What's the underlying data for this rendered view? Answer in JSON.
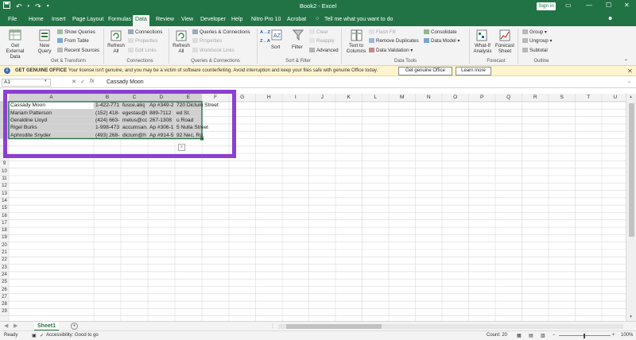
{
  "window": {
    "title": "Book2 - Excel",
    "sign_in": "Sign in",
    "qat_icons": [
      "save-icon",
      "undo-icon",
      "redo-icon",
      "customize-qat-icon"
    ],
    "controls": [
      "ribbon-display-icon",
      "minimize-icon",
      "maximize-icon",
      "close-icon"
    ]
  },
  "menu": {
    "tabs": [
      "File",
      "Home",
      "Insert",
      "Page Layout",
      "Formulas",
      "Data",
      "Review",
      "View",
      "Developer",
      "Help",
      "Nitro Pro 10",
      "Acrobat"
    ],
    "active_tab": "Data",
    "tell_me": "Tell me what you want to do",
    "share_icon": "share-icon"
  },
  "ribbon": {
    "get_external_data": "Get External\nData",
    "new_query": "New\nQuery",
    "show_queries": "Show Queries",
    "from_table": "From Table",
    "recent_sources": "Recent Sources",
    "group_get_transform": "Get & Transform",
    "refresh_all": "Refresh\nAll",
    "connections": "Connections",
    "properties": "Properties",
    "edit_links": "Edit Links",
    "group_connections": "Connections",
    "refresh_all_2": "Refresh\nAll",
    "queries_connections": "Queries & Connections",
    "properties_2": "Properties",
    "workbook_links": "Workbook Links",
    "group_queries_connections": "Queries & Connections",
    "sort_az": "A→Z",
    "sort_za": "Z→A",
    "sort": "Sort",
    "filter": "Filter",
    "clear": "Clear",
    "reapply": "Reapply",
    "advanced": "Advanced",
    "group_sort_filter": "Sort & Filter",
    "text_to_columns": "Text to\nColumns",
    "flash_fill": "Flash Fill",
    "remove_duplicates": "Remove Duplicates",
    "data_validation": "Data Validation",
    "consolidate": "Consolidate",
    "data_model": "Data Model",
    "group_data_tools": "Data Tools",
    "what_if": "What-If\nAnalysis",
    "forecast_sheet": "Forecast\nSheet",
    "group_forecast": "Forecast",
    "group_btn": "Group",
    "ungroup": "Ungroup",
    "subtotal": "Subtotal",
    "group_outline": "Outline"
  },
  "message_bar": {
    "title": "GET GENUINE OFFICE",
    "text": "Your license isn't genuine, and you may be a victim of software counterfeiting. Avoid interruption and keep your files safe with genuine Office today.",
    "primary_button": "Get genuine Office",
    "secondary_button": "Learn more"
  },
  "formula_bar": {
    "name_box": "A1",
    "fx_label": "fx",
    "cancel": "✕",
    "enter": "✓",
    "value": "Cassady Moon"
  },
  "sheet": {
    "columns": [
      "A",
      "B",
      "C",
      "D",
      "E",
      "F",
      "G",
      "H",
      "I",
      "J",
      "K",
      "L",
      "M",
      "N",
      "O",
      "P",
      "Q",
      "R",
      "S",
      "T",
      "U"
    ],
    "rows": [
      "1",
      "2",
      "3",
      "4",
      "5",
      "6",
      "7",
      "8",
      "9",
      "10",
      "11",
      "12",
      "13",
      "14",
      "15",
      "16",
      "17",
      "18",
      "19",
      "20",
      "21",
      "22",
      "23",
      "24",
      "25",
      "26",
      "27",
      "28",
      "29"
    ],
    "cells": {
      "A": [
        "Cassady Moon",
        "Mariam Patterson",
        "Geraldine Lloyd",
        "Rigel Burks",
        "Aphrodite Snyder"
      ],
      "B": [
        "1-422-771",
        "(152) 418-",
        "(424) 663-",
        "1-998-473",
        "(493) 268-"
      ],
      "C": [
        "fusce.aliq",
        "egestas@i",
        "metus@cc",
        "accumsan.",
        "dictum@h"
      ],
      "D": [
        "Ap #349-2",
        "889-7112",
        "267-1308",
        "Ap #306-1",
        "Ap #914-5"
      ],
      "E": [
        "720 Dictum Street",
        "ed St.",
        "u Road",
        "5 Nulla Street",
        "92 Nec, Rd."
      ]
    },
    "quick_analysis_icon": "quick-analysis-icon"
  },
  "sheet_tabs": {
    "active": "Sheet1",
    "add_icon": "+"
  },
  "status": {
    "ready": "Ready",
    "accessibility": "Accessibility: Good to go",
    "count": "Count: 20",
    "zoom": "100%"
  }
}
